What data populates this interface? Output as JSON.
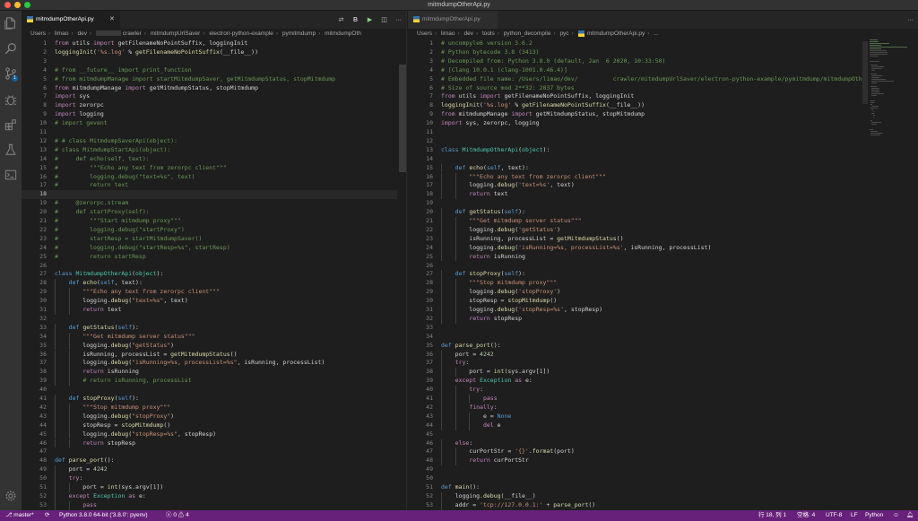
{
  "window": {
    "title": "mitmdumpOtherApi.py"
  },
  "activity_bar": {
    "scm_badge": "1"
  },
  "left": {
    "tab_label": "mitmdumpOtherApi.py",
    "breadcrumb": [
      "Users",
      "limao",
      "dev",
      "crawler",
      "mitmdumpUrlSaver",
      "electron-python-example",
      "pymitmdump",
      "mitmdumpOth"
    ],
    "lines": [
      {
        "n": "1",
        "t": "from utils import getFilenameNoPointSuffix, loggingInit"
      },
      {
        "n": "2",
        "t": "loggingInit('%s.log' % getFilenameNoPointSuffix(__file__))"
      },
      {
        "n": "3",
        "t": ""
      },
      {
        "n": "4",
        "t": "# from __future__ import print_function"
      },
      {
        "n": "5",
        "t": "# from mitmdumpManage import startMitmdumpSaver, getMitmdumpStatus, stopMitmdump"
      },
      {
        "n": "6",
        "t": "from mitmdumpManage import getMitmdumpStatus, stopMitmdump"
      },
      {
        "n": "7",
        "t": "import sys"
      },
      {
        "n": "8",
        "t": "import zerorpc"
      },
      {
        "n": "9",
        "t": "import logging"
      },
      {
        "n": "10",
        "t": "# import gevent"
      },
      {
        "n": "11",
        "t": ""
      },
      {
        "n": "12",
        "t": "# # class MitmdumpSaverApi(object):"
      },
      {
        "n": "13",
        "t": "# class MitmdumpStartApi(object):"
      },
      {
        "n": "14",
        "t": "#     def echo(self, text):"
      },
      {
        "n": "15",
        "t": "#         \"\"\"Echo any text from zerorpc client\"\"\""
      },
      {
        "n": "16",
        "t": "#         logging.debug(\"text=%s\", text)"
      },
      {
        "n": "17",
        "t": "#         return text"
      },
      {
        "n": "18",
        "t": ""
      },
      {
        "n": "19",
        "t": "#     @zerorpc.stream"
      },
      {
        "n": "20",
        "t": "#     def startProxy(self):"
      },
      {
        "n": "21",
        "t": "#         \"\"\"Start mitmdump proxy\"\"\""
      },
      {
        "n": "22",
        "t": "#         logging.debug(\"startProxy\")"
      },
      {
        "n": "23",
        "t": "#         startResp = startMitmdumpSaver()"
      },
      {
        "n": "24",
        "t": "#         logging.debug(\"startResp=%s\", startResp)"
      },
      {
        "n": "25",
        "t": "#         return startResp"
      },
      {
        "n": "26",
        "t": ""
      },
      {
        "n": "27",
        "t": "class MitmdumpOtherApi(object):"
      },
      {
        "n": "28",
        "t": "    def echo(self, text):"
      },
      {
        "n": "29",
        "t": "        \"\"\"Echo any text from zerorpc client\"\"\""
      },
      {
        "n": "30",
        "t": "        logging.debug(\"text=%s\", text)"
      },
      {
        "n": "31",
        "t": "        return text"
      },
      {
        "n": "32",
        "t": ""
      },
      {
        "n": "33",
        "t": "    def getStatus(self):"
      },
      {
        "n": "34",
        "t": "        \"\"\"Get mitmdump server status\"\"\""
      },
      {
        "n": "35",
        "t": "        logging.debug(\"getStatus\")"
      },
      {
        "n": "36",
        "t": "        isRunning, processList = getMitmdumpStatus()"
      },
      {
        "n": "37",
        "t": "        logging.debug(\"isRunning=%s, processList=%s\", isRunning, processList)"
      },
      {
        "n": "38",
        "t": "        return isRunning"
      },
      {
        "n": "39",
        "t": "        # return isRunning, processList"
      },
      {
        "n": "40",
        "t": ""
      },
      {
        "n": "41",
        "t": "    def stopProxy(self):"
      },
      {
        "n": "42",
        "t": "        \"\"\"Stop mitmdump proxy\"\"\""
      },
      {
        "n": "43",
        "t": "        logging.debug(\"stopProxy\")"
      },
      {
        "n": "44",
        "t": "        stopResp = stopMitmdump()"
      },
      {
        "n": "45",
        "t": "        logging.debug(\"stopResp=%s\", stopResp)"
      },
      {
        "n": "46",
        "t": "        return stopResp"
      },
      {
        "n": "47",
        "t": ""
      },
      {
        "n": "48",
        "t": "def parse_port():"
      },
      {
        "n": "49",
        "t": "    port = 4242"
      },
      {
        "n": "50",
        "t": "    try:"
      },
      {
        "n": "51",
        "t": "        port = int(sys.argv[1])"
      },
      {
        "n": "52",
        "t": "    except Exception as e:"
      },
      {
        "n": "53",
        "t": "        pass"
      }
    ]
  },
  "right": {
    "tab_label": "mitmdumpOtherApi.py",
    "breadcrumb": [
      "Users",
      "limao",
      "dev",
      "tools",
      "python_decompile",
      "pyc",
      "mitmdumpOtherApi.py",
      "..."
    ],
    "lines": [
      {
        "n": "1",
        "t": "# uncompyle6 version 3.6.2"
      },
      {
        "n": "2",
        "t": "# Python bytecode 3.8 (3413)"
      },
      {
        "n": "3",
        "t": "# Decompiled from: Python 3.8.0 (default, Jan  6 2020, 10:33:50)"
      },
      {
        "n": "4",
        "t": "# [Clang 10.0.1 (clang-1001.0.46.4)]"
      },
      {
        "n": "5",
        "t": "# Embedded file name: /Users/limao/dev/          crawler/mitmdumpUrlSaver/electron-python-example/pymitmdump/mitmdumpOth"
      },
      {
        "n": "6",
        "t": "# Size of source mod 2**32: 2837 bytes"
      },
      {
        "n": "7",
        "t": "from utils import getFilenameNoPointSuffix, loggingInit"
      },
      {
        "n": "8",
        "t": "loggingInit('%s.log' % getFilenameNoPointSuffix(__file__))"
      },
      {
        "n": "9",
        "t": "from mitmdumpManage import getMitmdumpStatus, stopMitmdump"
      },
      {
        "n": "10",
        "t": "import sys, zerorpc, logging"
      },
      {
        "n": "11",
        "t": ""
      },
      {
        "n": "12",
        "t": ""
      },
      {
        "n": "13",
        "t": "class MitmdumpOtherApi(object):"
      },
      {
        "n": "14",
        "t": ""
      },
      {
        "n": "15",
        "t": "    def echo(self, text):"
      },
      {
        "n": "16",
        "t": "        \"\"\"Echo any text from zerorpc client\"\"\""
      },
      {
        "n": "17",
        "t": "        logging.debug('text=%s', text)"
      },
      {
        "n": "18",
        "t": "        return text"
      },
      {
        "n": "19",
        "t": ""
      },
      {
        "n": "20",
        "t": "    def getStatus(self):"
      },
      {
        "n": "21",
        "t": "        \"\"\"Get mitmdump server status\"\"\""
      },
      {
        "n": "22",
        "t": "        logging.debug('getStatus')"
      },
      {
        "n": "23",
        "t": "        isRunning, processList = getMitmdumpStatus()"
      },
      {
        "n": "24",
        "t": "        logging.debug('isRunning=%s, processList=%s', isRunning, processList)"
      },
      {
        "n": "25",
        "t": "        return isRunning"
      },
      {
        "n": "26",
        "t": ""
      },
      {
        "n": "27",
        "t": "    def stopProxy(self):"
      },
      {
        "n": "28",
        "t": "        \"\"\"Stop mitmdump proxy\"\"\""
      },
      {
        "n": "29",
        "t": "        logging.debug('stopProxy')"
      },
      {
        "n": "30",
        "t": "        stopResp = stopMitmdump()"
      },
      {
        "n": "31",
        "t": "        logging.debug('stopResp=%s', stopResp)"
      },
      {
        "n": "32",
        "t": "        return stopResp"
      },
      {
        "n": "33",
        "t": ""
      },
      {
        "n": "34",
        "t": ""
      },
      {
        "n": "35",
        "t": "def parse_port():"
      },
      {
        "n": "36",
        "t": "    port = 4242"
      },
      {
        "n": "37",
        "t": "    try:"
      },
      {
        "n": "38",
        "t": "        port = int(sys.argv[1])"
      },
      {
        "n": "39",
        "t": "    except Exception as e:"
      },
      {
        "n": "40",
        "t": "        try:"
      },
      {
        "n": "41",
        "t": "            pass"
      },
      {
        "n": "42",
        "t": "        finally:"
      },
      {
        "n": "43",
        "t": "            e = None"
      },
      {
        "n": "44",
        "t": "            del e"
      },
      {
        "n": "45",
        "t": ""
      },
      {
        "n": "46",
        "t": "    else:"
      },
      {
        "n": "47",
        "t": "        curPortStr = '{}'.format(port)"
      },
      {
        "n": "48",
        "t": "        return curPortStr"
      },
      {
        "n": "49",
        "t": ""
      },
      {
        "n": "50",
        "t": ""
      },
      {
        "n": "51",
        "t": "def main():"
      },
      {
        "n": "52",
        "t": "    logging.debug(__file__)"
      },
      {
        "n": "53",
        "t": "    addr = 'tcp://127.0.0.1:' + parse_port()"
      },
      {
        "n": "54",
        "t": "    logging.debug('addr=%s', addr)"
      }
    ]
  },
  "status": {
    "branch": "master*",
    "python": "Python 3.8.0 64-bit ('3.8.0': pyenv)",
    "errors": "0",
    "warnings": "4",
    "cursor": "行 18, 列 1",
    "spaces": "空格: 4",
    "encoding": "UTF-8",
    "eol": "LF",
    "language": "Python"
  },
  "colors": {
    "statusbar": "#68217a",
    "editor_bg": "#1e1e1e",
    "keyword": "#c586c0",
    "string": "#ce9178",
    "comment": "#6a9955"
  }
}
